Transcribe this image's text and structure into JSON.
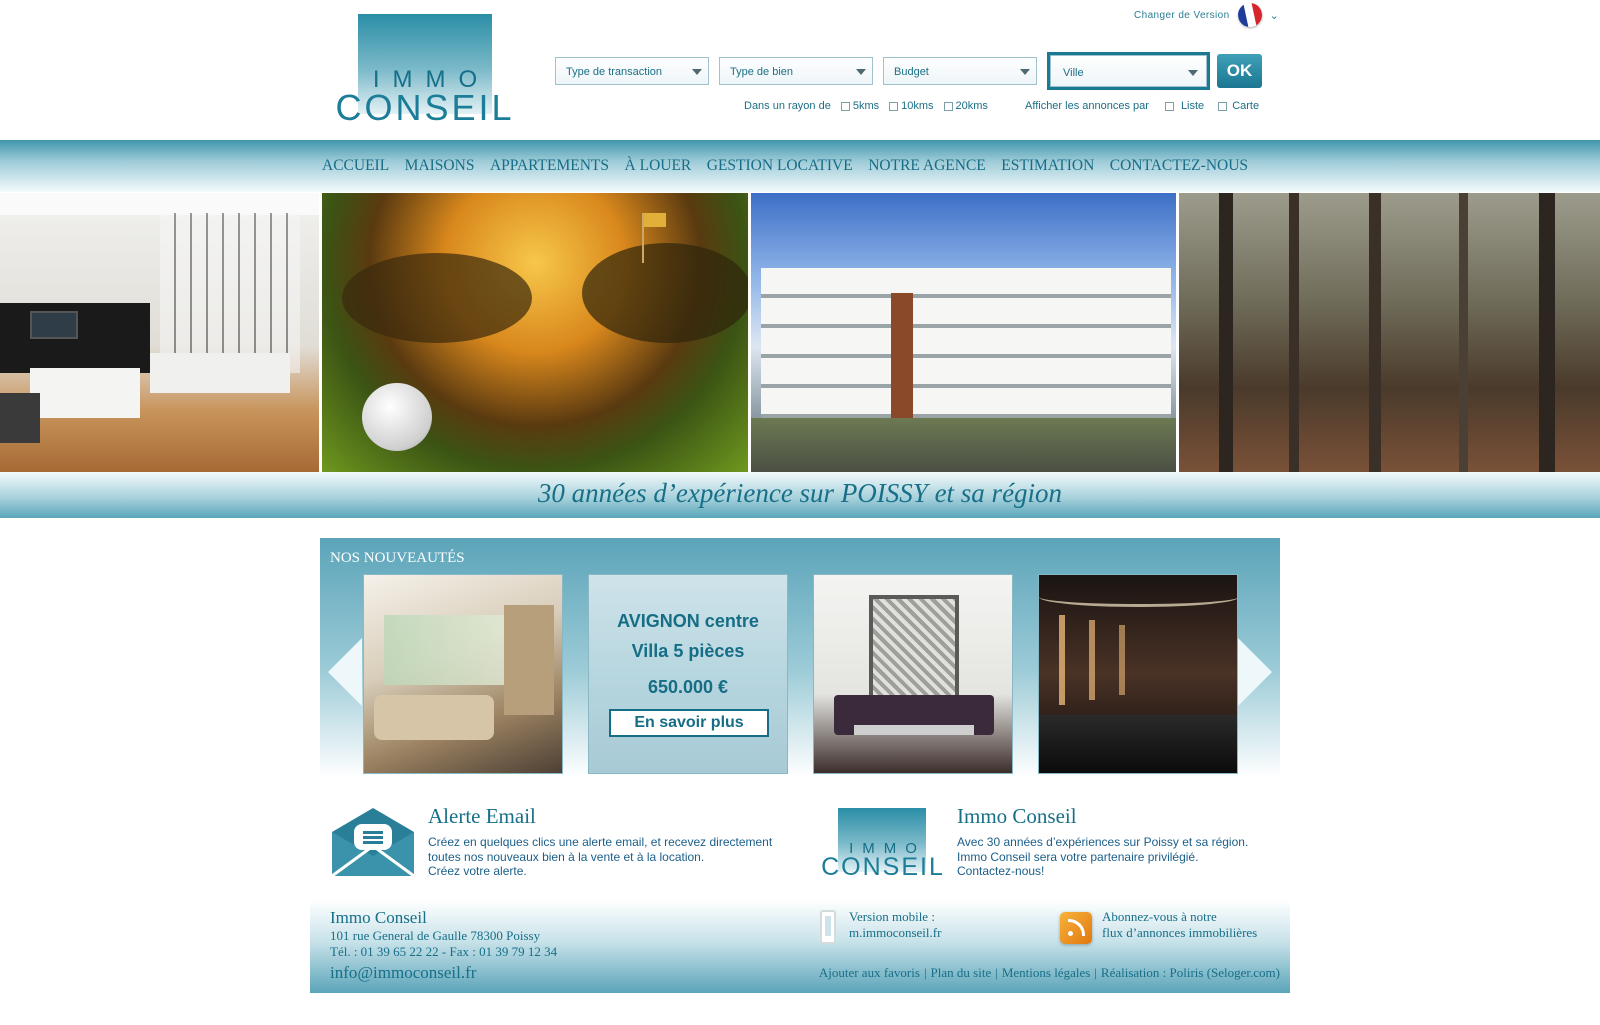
{
  "header": {
    "logo": {
      "line1": "IMMO",
      "line2": "CONSEIL"
    },
    "version": {
      "label": "Changer de Version",
      "flag_icon": "france-flag-icon",
      "chevron_icon": "chevron-down-icon"
    },
    "search": {
      "transaction": "Type de transaction",
      "bien": "Type de bien",
      "budget": "Budget",
      "ville": "Ville",
      "ok": "OK"
    },
    "radius": {
      "label": "Dans un rayon de",
      "options": [
        "5kms",
        "10kms",
        "20kms"
      ]
    },
    "display": {
      "label": "Afficher les annonces par",
      "options": [
        "Liste",
        "Carte"
      ]
    }
  },
  "nav": {
    "items": [
      "ACCUEIL",
      "MAISONS",
      "APPARTEMENTS",
      "À LOUER",
      "GESTION LOCATIVE",
      "NOTRE AGENCE",
      "ESTIMATION",
      "CONTACTEZ-NOUS"
    ]
  },
  "hero": {
    "tagline": "30 années d’expérience sur POISSY et sa région"
  },
  "news": {
    "title": "NOS NOUVEAUTÉS",
    "featured": {
      "line1": "AVIGNON centre",
      "line2": "Villa 5 pièces",
      "price": "650.000 €",
      "button": "En savoir plus"
    }
  },
  "info": {
    "alert": {
      "title": "Alerte Email",
      "lines": [
        "Créez en quelques clics une alerte email, et recevez directement",
        "toutes nos nouveaux bien à la vente et à la location.",
        "Créez votre alerte."
      ]
    },
    "agency": {
      "title": "Immo Conseil",
      "lines": [
        "Avec 30 années d’expériences sur Poissy et sa région.",
        "Immo Conseil sera votre partenaire privilégié.",
        "Contactez-nous!"
      ]
    }
  },
  "footer": {
    "name": "Immo Conseil",
    "address": "101 rue General de Gaulle 78300 Poissy",
    "phone": "Tél. : 01 39 65 22 22  -  Fax : 01 39 79 12 34",
    "email": "info@immoconseil.fr",
    "mobile": {
      "line1": "Version mobile :",
      "line2": "m.immoconseil.fr"
    },
    "rss": {
      "line1": "Abonnez-vous à notre",
      "line2": "flux d’annonces immobilières"
    },
    "links": [
      "Ajouter aux favoris",
      "Plan du site",
      "Mentions légales",
      "Réalisation : Poliris (Seloger.com)"
    ]
  },
  "colors": {
    "brand": "#1b7791",
    "accent": "#5ba4b9",
    "text": "#176f88"
  }
}
